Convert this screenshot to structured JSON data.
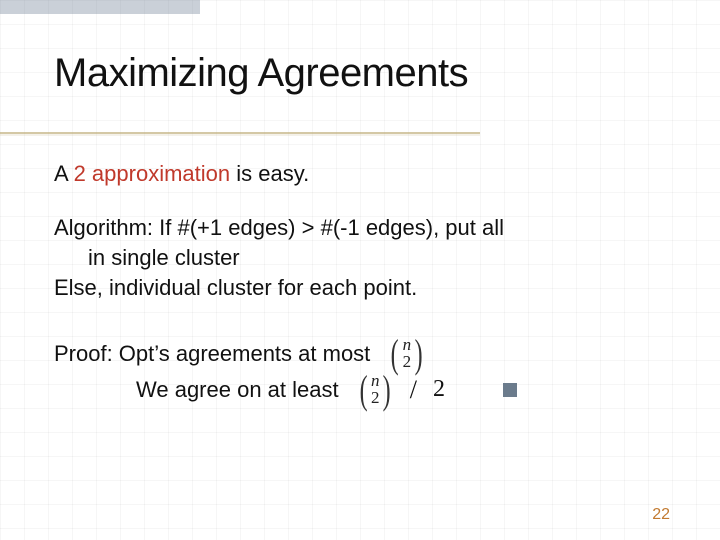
{
  "slide": {
    "title": "Maximizing Agreements",
    "line1_prefix": "A ",
    "line1_highlight": "2 approximation",
    "line1_suffix": " is easy.",
    "algo_l1": "Algorithm: If #(+1 edges) > #(-1 edges), put all",
    "algo_l2": "in single cluster",
    "algo_l3": "Else, individual cluster for each point.",
    "proof_l1": "Proof: Opt’s agreements at most",
    "proof_l2": "We agree on at least",
    "binom_top": "n",
    "binom_bot": "2",
    "divide_by": "2",
    "page_number": "22"
  }
}
